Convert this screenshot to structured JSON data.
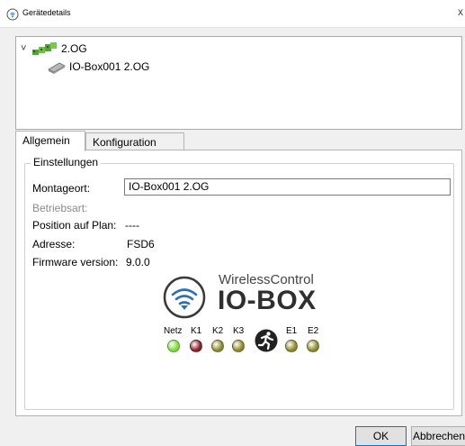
{
  "window": {
    "title": "Gerätedetails",
    "close_glyph": "x"
  },
  "tree": {
    "root": {
      "label": "2.OG",
      "icon": "floor-devices-icon",
      "expanded": true
    },
    "child": {
      "label": "IO-Box001 2.OG",
      "icon": "io-box-icon"
    }
  },
  "tabs": [
    {
      "label": "Allgemein",
      "active": true
    },
    {
      "label": "Konfiguration",
      "active": false
    }
  ],
  "settings": {
    "group_label": "Einstellungen",
    "montageort_label": "Montageort:",
    "montageort_value": "IO-Box001 2.OG",
    "betriebsart_label": "Betriebsart:",
    "position_label": "Position auf Plan:",
    "position_value": "----",
    "adresse_label": "Adresse:",
    "adresse_value": "FSD6",
    "firmware_label": "Firmware version:",
    "firmware_value": "9.0.0"
  },
  "device": {
    "brand": "WirelessControl",
    "product": "IO-BOX",
    "leds": [
      {
        "label": "Netz",
        "color": "#7ddc3a"
      },
      {
        "label": "K1",
        "color": "#8a1f2b"
      },
      {
        "label": "K2",
        "color": "#8d8a2a"
      },
      {
        "label": "K3",
        "color": "#8d8a2a"
      },
      {
        "label": "E1",
        "color": "#8d8a2a"
      },
      {
        "label": "E2",
        "color": "#8d8a2a"
      }
    ]
  },
  "buttons": {
    "ok": "OK",
    "cancel": "Abbrechen"
  }
}
